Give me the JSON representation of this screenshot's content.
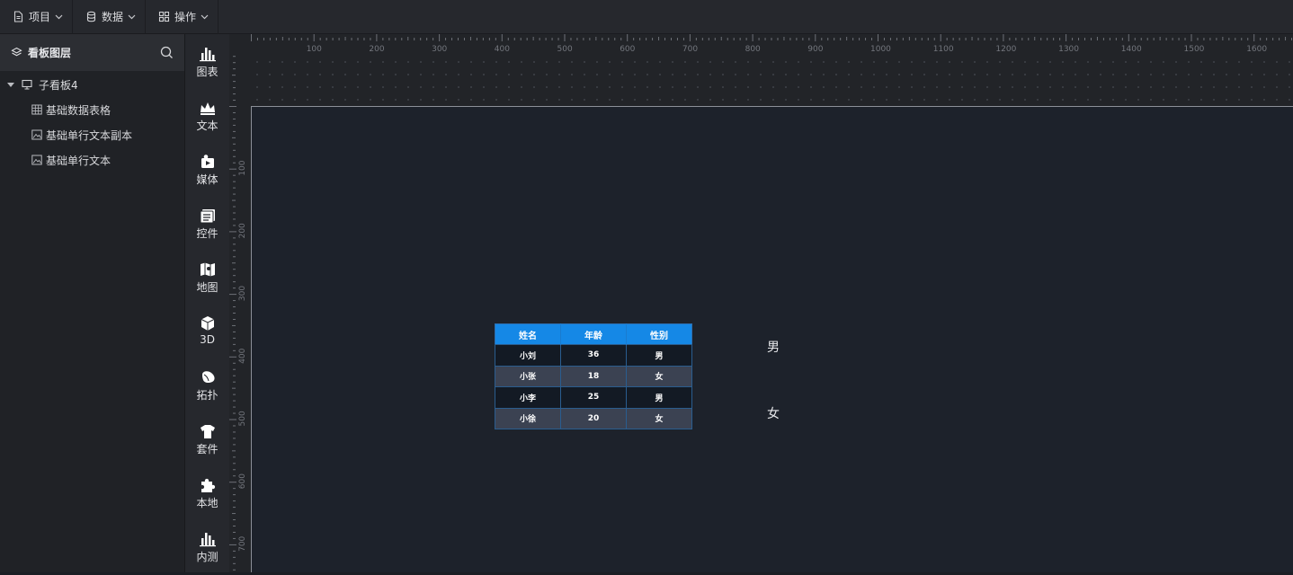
{
  "toolbar": {
    "menus": [
      {
        "label": "项目",
        "icon": "file-icon"
      },
      {
        "label": "数据",
        "icon": "database-icon"
      },
      {
        "label": "操作",
        "icon": "grid-icon"
      }
    ]
  },
  "layers": {
    "title": "看板图层",
    "root": {
      "label": "子看板4"
    },
    "items": [
      {
        "label": "基础数据表格",
        "icon": "table-icon"
      },
      {
        "label": "基础单行文本副本",
        "icon": "image-text-icon"
      },
      {
        "label": "基础单行文本",
        "icon": "image-text-icon"
      }
    ]
  },
  "palette": {
    "items": [
      {
        "label": "图表",
        "icon": "bar-chart-icon"
      },
      {
        "label": "文本",
        "icon": "crown-text-icon"
      },
      {
        "label": "媒体",
        "icon": "media-icon"
      },
      {
        "label": "控件",
        "icon": "control-icon"
      },
      {
        "label": "地图",
        "icon": "map-icon"
      },
      {
        "label": "3D",
        "icon": "cube-icon"
      },
      {
        "label": "拓扑",
        "icon": "topology-icon"
      },
      {
        "label": "套件",
        "icon": "shirt-icon"
      },
      {
        "label": "本地",
        "icon": "puzzle-icon"
      },
      {
        "label": "内测",
        "icon": "bar-chart-icon"
      }
    ]
  },
  "ruler": {
    "top_labels": [
      "100",
      "200",
      "300",
      "400",
      "500",
      "600",
      "700",
      "800",
      "900",
      "1000",
      "1100",
      "1200",
      "1300",
      "1400",
      "1500",
      "1600"
    ],
    "left_labels": [
      "100",
      "200",
      "300",
      "400",
      "500",
      "600",
      "700"
    ]
  },
  "canvas": {
    "table": {
      "headers": [
        "姓名",
        "年龄",
        "性别"
      ],
      "rows": [
        [
          "小刘",
          "36",
          "男"
        ],
        [
          "小张",
          "18",
          "女"
        ],
        [
          "小李",
          "25",
          "男"
        ],
        [
          "小徐",
          "20",
          "女"
        ]
      ]
    },
    "text_male": "男",
    "text_female": "女"
  },
  "colors": {
    "table_header": "#1588e6",
    "canvas_bg": "#1d222b"
  }
}
